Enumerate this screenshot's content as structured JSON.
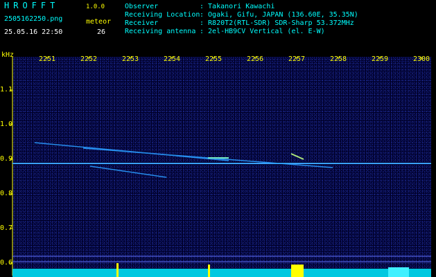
{
  "header": {
    "brand": "HROFFT",
    "version": "1.0.0",
    "filename": "2505162250.png",
    "datetime": "25.05.16 22:50",
    "meteor_label": "meteor",
    "meteor_count": "26"
  },
  "info": [
    {
      "label": "Observer",
      "value": ": Takanori Kawachi"
    },
    {
      "label": "Receiving Location",
      "value": ": Ogaki, Gifu, JAPAN (136.60E, 35.35N)"
    },
    {
      "label": "Receiver",
      "value": ": R820T2(RTL-SDR) SDR-Sharp 53.372MHz"
    },
    {
      "label": "Receiving antenna",
      "value": ": 2el-HB9CV Vertical (el. E-W)"
    }
  ],
  "axis": {
    "unit": "kHz",
    "x_labels": [
      "2251",
      "2252",
      "2253",
      "2254",
      "2255",
      "2256",
      "2257",
      "2258",
      "2259",
      "2300"
    ],
    "y_labels": [
      "1.1",
      "1.0",
      "0.9",
      "0.8",
      "0.7",
      "0.6"
    ]
  },
  "colors": {
    "text_primary": "#00ffff",
    "axis": "#ffff00",
    "background": "#000000",
    "plot_bg": "#00002a",
    "signal": "#00d0ff"
  }
}
